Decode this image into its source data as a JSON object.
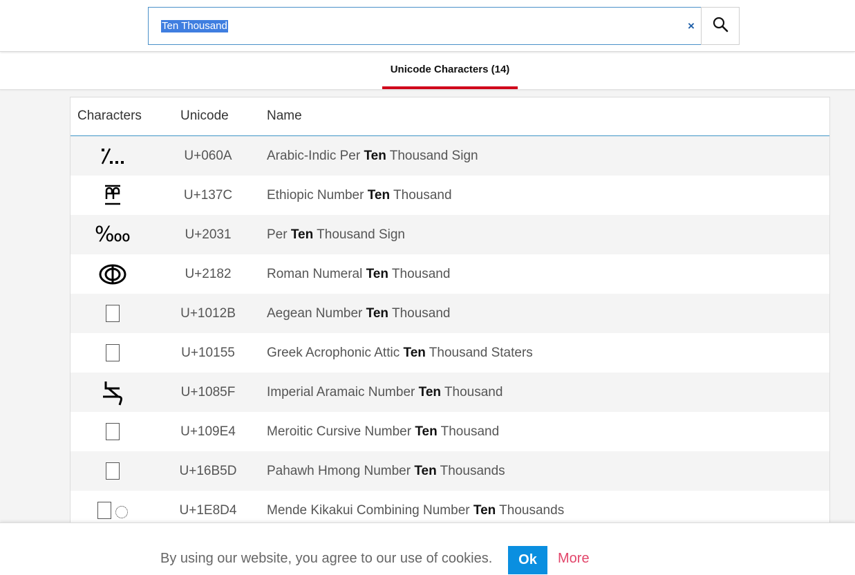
{
  "search": {
    "value": "Ten Thousand",
    "clear_label": "×",
    "search_icon": "search-icon"
  },
  "tabs": [
    {
      "label": "Unicode Characters (14)",
      "active": true,
      "underline_color": "#d0021b"
    }
  ],
  "table": {
    "headers": {
      "characters": "Characters",
      "unicode": "Unicode",
      "name": "Name"
    },
    "rows": [
      {
        "char": "؊",
        "unicode": "U+060A",
        "name_before": "Arabic-Indic Per ",
        "name_match": "Ten",
        "name_after": " Thousand Sign",
        "rendered": "glyph"
      },
      {
        "char": "፼",
        "unicode": "U+137C",
        "name_before": "Ethiopic Number ",
        "name_match": "Ten",
        "name_after": " Thousand",
        "rendered": "glyph"
      },
      {
        "char": "‱",
        "unicode": "U+2031",
        "name_before": "Per ",
        "name_match": "Ten",
        "name_after": " Thousand Sign",
        "rendered": "glyph"
      },
      {
        "char": "ↂ",
        "unicode": "U+2182",
        "name_before": "Roman Numeral ",
        "name_match": "Ten",
        "name_after": " Thousand",
        "rendered": "glyph"
      },
      {
        "char": "",
        "unicode": "U+1012B",
        "name_before": "Aegean Number ",
        "name_match": "Ten",
        "name_after": " Thousand",
        "rendered": "tofu"
      },
      {
        "char": "",
        "unicode": "U+10155",
        "name_before": "Greek Acrophonic Attic ",
        "name_match": "Ten",
        "name_after": " Thousand Staters",
        "rendered": "tofu"
      },
      {
        "char": "",
        "unicode": "U+1085F",
        "name_before": "Imperial Aramaic Number ",
        "name_match": "Ten",
        "name_after": " Thousand",
        "rendered": "glyph"
      },
      {
        "char": "",
        "unicode": "U+109E4",
        "name_before": "Meroitic Cursive Number ",
        "name_match": "Ten",
        "name_after": " Thousand",
        "rendered": "tofu"
      },
      {
        "char": "",
        "unicode": "U+16B5D",
        "name_before": "Pahawh Hmong Number ",
        "name_match": "Ten",
        "name_after": " Thousands",
        "rendered": "tofu"
      },
      {
        "char": "",
        "unicode": "U+1E8D4",
        "name_before": "Mende Kikakui Combining Number ",
        "name_match": "Ten",
        "name_after": " Thousands",
        "rendered": "tofu-combining"
      }
    ]
  },
  "cookie_bar": {
    "text": "By using our website, you agree to our use of cookies.",
    "ok_label": "Ok",
    "more_label": "More",
    "ok_color": "#0a8fe0",
    "more_color": "#e2456a"
  }
}
